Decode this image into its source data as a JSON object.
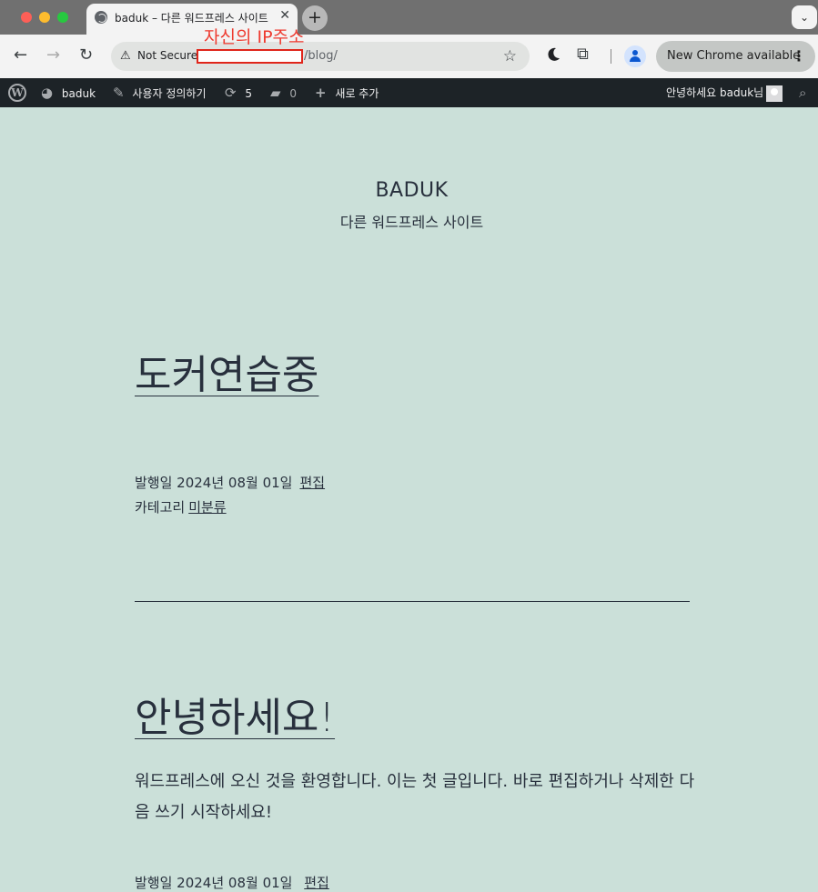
{
  "browser": {
    "tab_title": "baduk – 다른 워드프레스 사이트",
    "security_label": "Not Secure",
    "url_path": "/blog/",
    "annotation": "자신의 IP주소",
    "update_button": "New Chrome available"
  },
  "adminbar": {
    "site_name": "baduk",
    "customize": "사용자 정의하기",
    "updates_count": "5",
    "comments_count": "0",
    "new_content": "새로 추가",
    "greeting": "안녕하세요 baduk님"
  },
  "site": {
    "title": "BADUK",
    "description": "다른 워드프레스 사이트"
  },
  "posts": [
    {
      "title": "도커연습중",
      "published": "발행일 2024년 08월 01일",
      "edit": "편집",
      "category_label": "카테고리",
      "category": "미분류"
    },
    {
      "title": "안녕하세요!",
      "excerpt": "워드프레스에 오신 것을 환영합니다. 이는 첫 글입니다. 바로 편집하거나 삭제한 다음 쓰기 시작하세요!",
      "published": "발행일 2024년 08월 01일",
      "edit": "편집"
    }
  ]
}
